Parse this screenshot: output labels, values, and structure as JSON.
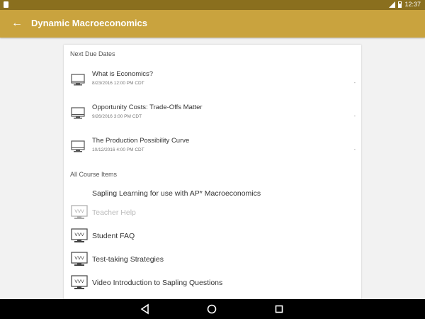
{
  "status_bar": {
    "time": "12:37"
  },
  "app_bar": {
    "title": "Dynamic Macroeconomics",
    "back_icon": "arrow-left-icon"
  },
  "next_due": {
    "header": "Next Due Dates",
    "items": [
      {
        "title": "What is Economics?",
        "date": "8/23/2016 12:00 PM CDT",
        "dash": "-"
      },
      {
        "title": "Opportunity Costs: Trade-Offs Matter",
        "date": "9/26/2016 3:00 PM CDT",
        "dash": "-"
      },
      {
        "title": "The Production Possibility Curve",
        "date": "10/12/2016 4:00 PM CDT",
        "dash": "-"
      }
    ]
  },
  "course_items": {
    "header": "All Course Items",
    "items": [
      {
        "label": "Sapling Learning for use with AP* Macroeconomics",
        "has_icon": false,
        "disabled": false
      },
      {
        "label": "Teacher Help",
        "has_icon": true,
        "disabled": true
      },
      {
        "label": "Student FAQ",
        "has_icon": true,
        "disabled": false
      },
      {
        "label": "Test-taking Strategies",
        "has_icon": true,
        "disabled": false
      },
      {
        "label": "Video Introduction to Sapling Questions",
        "has_icon": true,
        "disabled": false
      }
    ]
  },
  "colors": {
    "accent": "#c9a33e",
    "status_bar": "#8a6f1e",
    "nav_bar": "#000000"
  }
}
